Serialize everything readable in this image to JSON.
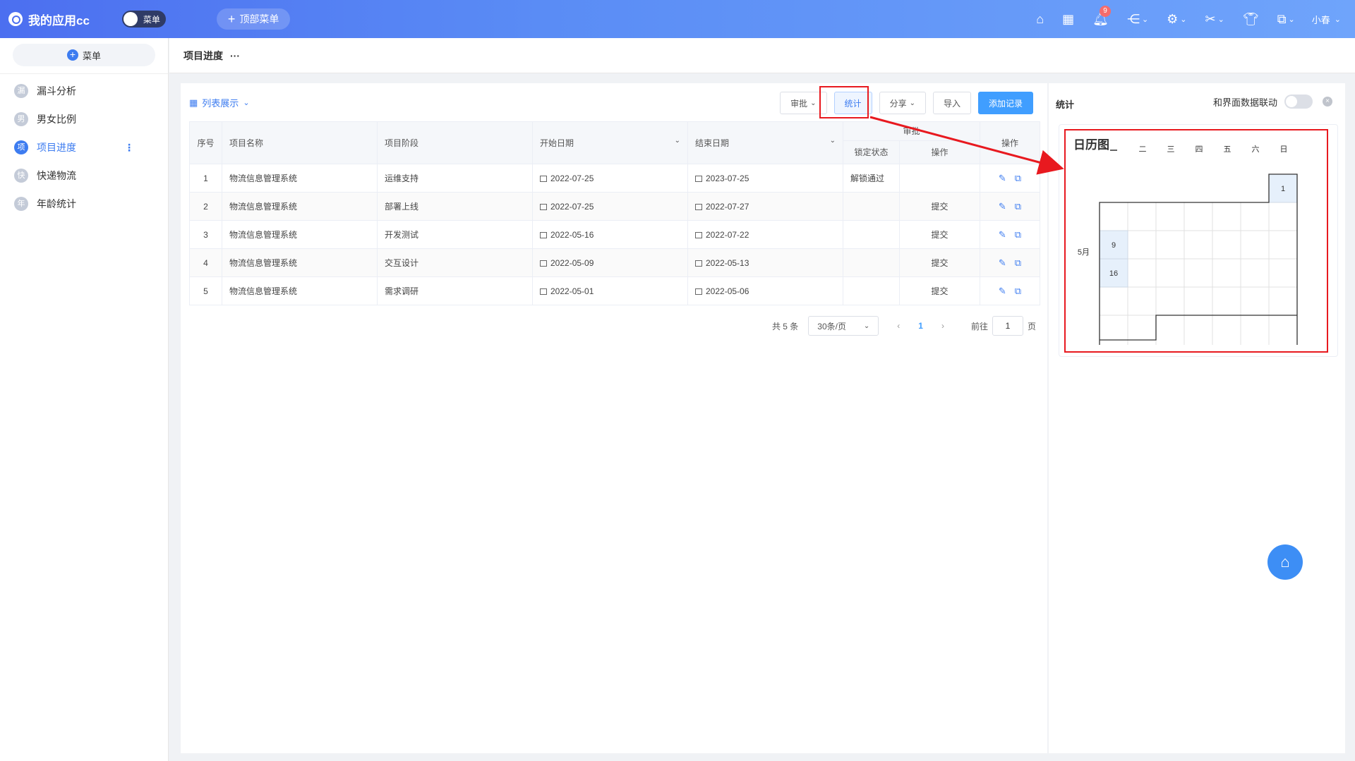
{
  "app": {
    "title": "我的应用cc",
    "menu_toggle_label": "菜单",
    "top_menu_label": "顶部菜单",
    "user_name": "小春",
    "notification_count": "9"
  },
  "sidebar": {
    "menu_button_label": "菜单",
    "items": [
      {
        "avatar": "漏",
        "label": "漏斗分析"
      },
      {
        "avatar": "男",
        "label": "男女比例"
      },
      {
        "avatar": "项",
        "label": "项目进度"
      },
      {
        "avatar": "快",
        "label": "快递物流"
      },
      {
        "avatar": "年",
        "label": "年龄统计"
      }
    ]
  },
  "page": {
    "title": "项目进度",
    "more": "···"
  },
  "main": {
    "view_label": "列表展示",
    "toolbar": {
      "approve": "审批",
      "stats": "统计",
      "share": "分享",
      "import": "导入",
      "add": "添加记录"
    },
    "table": {
      "headers": {
        "index": "序号",
        "name": "项目名称",
        "stage": "项目阶段",
        "start": "开始日期",
        "end": "结束日期",
        "approval": "审批",
        "lock_status": "锁定状态",
        "approval_op": "操作",
        "ops": "操作"
      },
      "rows": [
        {
          "index": "1",
          "name": "物流信息管理系统",
          "stage": "运维支持",
          "start": "2022-07-25",
          "end": "2023-07-25",
          "lock": "解锁通过",
          "submit": ""
        },
        {
          "index": "2",
          "name": "物流信息管理系统",
          "stage": "部署上线",
          "start": "2022-07-25",
          "end": "2022-07-27",
          "lock": "",
          "submit": "提交"
        },
        {
          "index": "3",
          "name": "物流信息管理系统",
          "stage": "开发测试",
          "start": "2022-05-16",
          "end": "2022-07-22",
          "lock": "",
          "submit": "提交"
        },
        {
          "index": "4",
          "name": "物流信息管理系统",
          "stage": "交互设计",
          "start": "2022-05-09",
          "end": "2022-05-13",
          "lock": "",
          "submit": "提交"
        },
        {
          "index": "5",
          "name": "物流信息管理系统",
          "stage": "需求调研",
          "start": "2022-05-01",
          "end": "2022-05-06",
          "lock": "",
          "submit": "提交"
        }
      ]
    },
    "pager": {
      "total": "共 5 条",
      "page_size": "30条/页",
      "current": "1",
      "goto": "前往",
      "goto_value": "1",
      "page_unit": "页"
    }
  },
  "right": {
    "title": "统计",
    "link_label": "和界面数据联动",
    "calendar": {
      "title": "日历图",
      "weekdays": [
        "二",
        "三",
        "四",
        "五",
        "六",
        "日"
      ],
      "month_label": "5月",
      "day_1": "1",
      "day_9": "9",
      "day_16": "16"
    }
  },
  "colors": {
    "accent": "#409eff",
    "highlight_box": "#e8191f"
  }
}
